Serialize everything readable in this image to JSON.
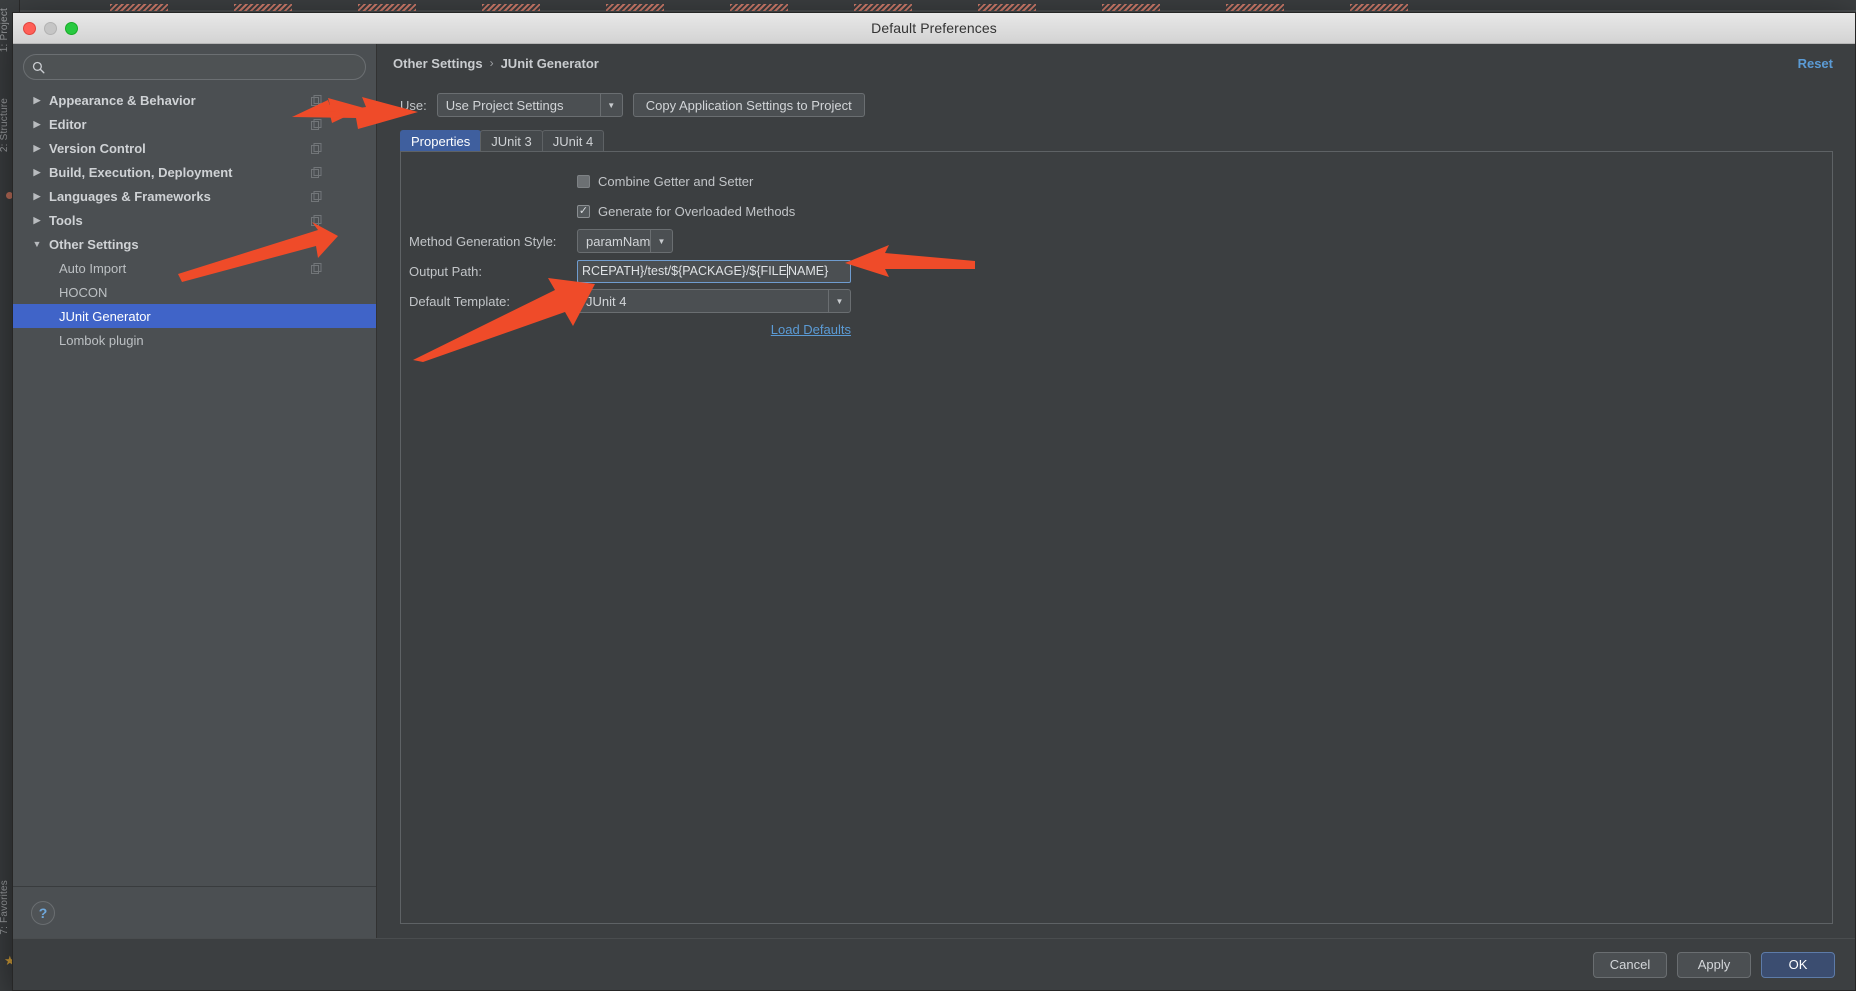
{
  "window": {
    "title": "Default Preferences",
    "traffic_lights": [
      "close-red",
      "minimize-gray",
      "zoom-green"
    ]
  },
  "sidebar": {
    "search": {
      "value": "",
      "placeholder": ""
    },
    "items": [
      {
        "label": "Appearance & Behavior",
        "level": "top",
        "expanded": false,
        "selected": false,
        "copy_icon": true
      },
      {
        "label": "Editor",
        "level": "top",
        "expanded": false,
        "selected": false,
        "copy_icon": true
      },
      {
        "label": "Version Control",
        "level": "top",
        "expanded": false,
        "selected": false,
        "copy_icon": true
      },
      {
        "label": "Build, Execution, Deployment",
        "level": "top",
        "expanded": false,
        "selected": false,
        "copy_icon": true
      },
      {
        "label": "Languages & Frameworks",
        "level": "top",
        "expanded": false,
        "selected": false,
        "copy_icon": true
      },
      {
        "label": "Tools",
        "level": "top",
        "expanded": false,
        "selected": false,
        "copy_icon": true
      },
      {
        "label": "Other Settings",
        "level": "top",
        "expanded": true,
        "selected": false,
        "copy_icon": false
      },
      {
        "label": "Auto Import",
        "level": "child",
        "expanded": false,
        "selected": false,
        "copy_icon": true
      },
      {
        "label": "HOCON",
        "level": "child",
        "expanded": false,
        "selected": false,
        "copy_icon": false
      },
      {
        "label": "JUnit Generator",
        "level": "child",
        "expanded": false,
        "selected": true,
        "copy_icon": false
      },
      {
        "label": "Lombok plugin",
        "level": "child",
        "expanded": false,
        "selected": false,
        "copy_icon": false
      }
    ],
    "help_glyph": "?"
  },
  "main": {
    "breadcrumb": {
      "parent": "Other Settings",
      "separator": "›",
      "current": "JUnit Generator"
    },
    "reset_label": "Reset",
    "use_row": {
      "label": "Use:",
      "selected": "Use Project Settings",
      "copy_button_label": "Copy Application Settings to Project"
    },
    "tabs": [
      {
        "label": "Properties",
        "active": true
      },
      {
        "label": "JUnit 3",
        "active": false
      },
      {
        "label": "JUnit 4",
        "active": false
      }
    ],
    "form": {
      "combine_getter_setter": {
        "label": "Combine Getter and Setter",
        "checked": false
      },
      "generate_overloaded": {
        "label": "Generate for Overloaded Methods",
        "checked": true
      },
      "method_generation_style": {
        "label": "Method Generation Style:",
        "value": "paramName"
      },
      "output_path": {
        "label": "Output Path:",
        "value": "RCEPATH}/test/${PACKAGE}/${FILENAME}"
      },
      "default_template": {
        "label": "Default Template:",
        "value": "JUnit 4"
      },
      "load_defaults_label": "Load Defaults"
    }
  },
  "footer": {
    "buttons": [
      {
        "label": "Cancel",
        "primary": false
      },
      {
        "label": "Apply",
        "primary": false
      },
      {
        "label": "OK",
        "primary": true
      }
    ]
  },
  "backdrop": {
    "rail_labels": [
      "1: Project",
      "2: Structure",
      "7: Favorites"
    ]
  },
  "colors": {
    "accent_selection": "#4064c8",
    "link": "#5b9bd5",
    "annotation_arrow": "#ef4b29",
    "active_tab": "#3f5f9e",
    "primary_button": "#3b4d70",
    "panel_bg": "#3c3f41",
    "sidebar_bg": "#4b4f52"
  }
}
